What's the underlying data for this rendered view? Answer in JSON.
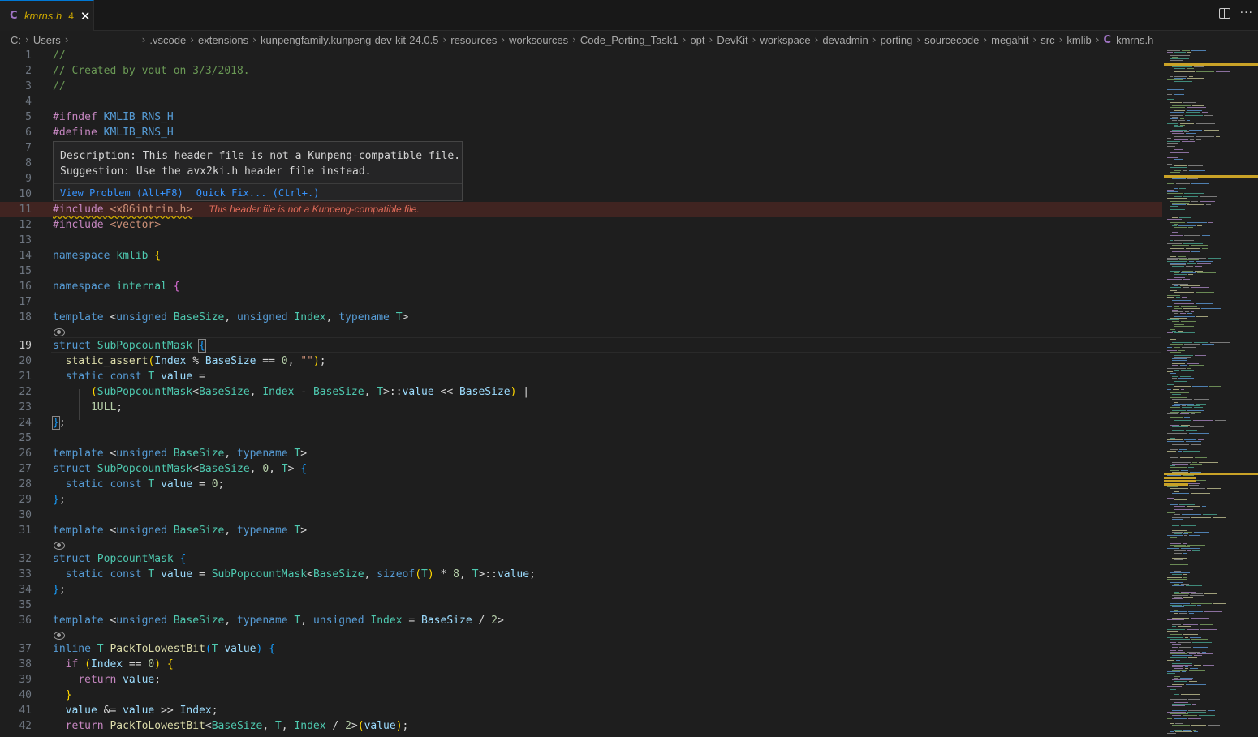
{
  "tab": {
    "icon": "c-language-icon",
    "icon_glyph": "C",
    "filename": "kmrns.h",
    "problem_count": "4",
    "close_glyph": "✕"
  },
  "toolbar": {
    "split_editor": "split-editor-icon",
    "more_actions_glyph": "···"
  },
  "breadcrumb": {
    "segments": [
      "C:",
      "Users",
      "",
      ".vscode",
      "extensions",
      "kunpengfamily.kunpeng-dev-kit-24.0.5",
      "resources",
      "worksources",
      "Code_Porting_Task1",
      "opt",
      "DevKit",
      "workspace",
      "devadmin",
      "porting",
      "sourcecode",
      "megahit",
      "src",
      "kmlib"
    ],
    "file_icon_glyph": "C",
    "file": "kmrns.h"
  },
  "hover": {
    "description": "Description: This header file is not a Kunpeng-compatible file.",
    "suggestion": "Suggestion: Use the avx2ki.h header file instead.",
    "view_problem": "View Problem (Alt+F8)",
    "quick_fix": "Quick Fix... (Ctrl+.)"
  },
  "inline_error": "This header file is not a Kunpeng-compatible file.",
  "active_line": 19,
  "line_numbers": [
    "1",
    "2",
    "3",
    "4",
    "5",
    "6",
    "7",
    "8",
    "9",
    "10",
    "11",
    "12",
    "13",
    "14",
    "15",
    "16",
    "17",
    "18",
    "19",
    "20",
    "21",
    "22",
    "23",
    "24",
    "25",
    "26",
    "27",
    "28",
    "29",
    "30",
    "31",
    "32",
    "33",
    "34",
    "35",
    "36",
    "37",
    "38",
    "39",
    "40",
    "41",
    "42"
  ],
  "code": {
    "l1": "//",
    "l2": "// Created by vout on 3/3/2018.",
    "l3": "//",
    "l5a": "#ifndef",
    "l5b": "KMLIB_RNS_H",
    "l6a": "#define",
    "l6b": "KMLIB_RNS_H",
    "l11a": "#include",
    "l11b": "<x86intrin.h>",
    "l12a": "#include",
    "l12b": "<vector>",
    "namespace": "namespace",
    "kmlib": "kmlib",
    "internal": "internal",
    "template": "template",
    "unsigned": "unsigned",
    "typename": "typename",
    "struct": "struct",
    "static": "static",
    "const": "const",
    "inline": "inline",
    "if": "if",
    "return": "return",
    "sizeof": "sizeof",
    "BaseSize": "BaseSize",
    "Index": "Index",
    "T": "T",
    "value": "value",
    "SubPopcountMask": "SubPopcountMask",
    "PopcountMask": "PopcountMask",
    "PackToLowestBit": "PackToLowestBit",
    "static_assert": "static_assert",
    "ULL": "1ULL",
    "zero": "0",
    "eight": "8",
    "two": "2",
    "empty_str": "\"\""
  }
}
